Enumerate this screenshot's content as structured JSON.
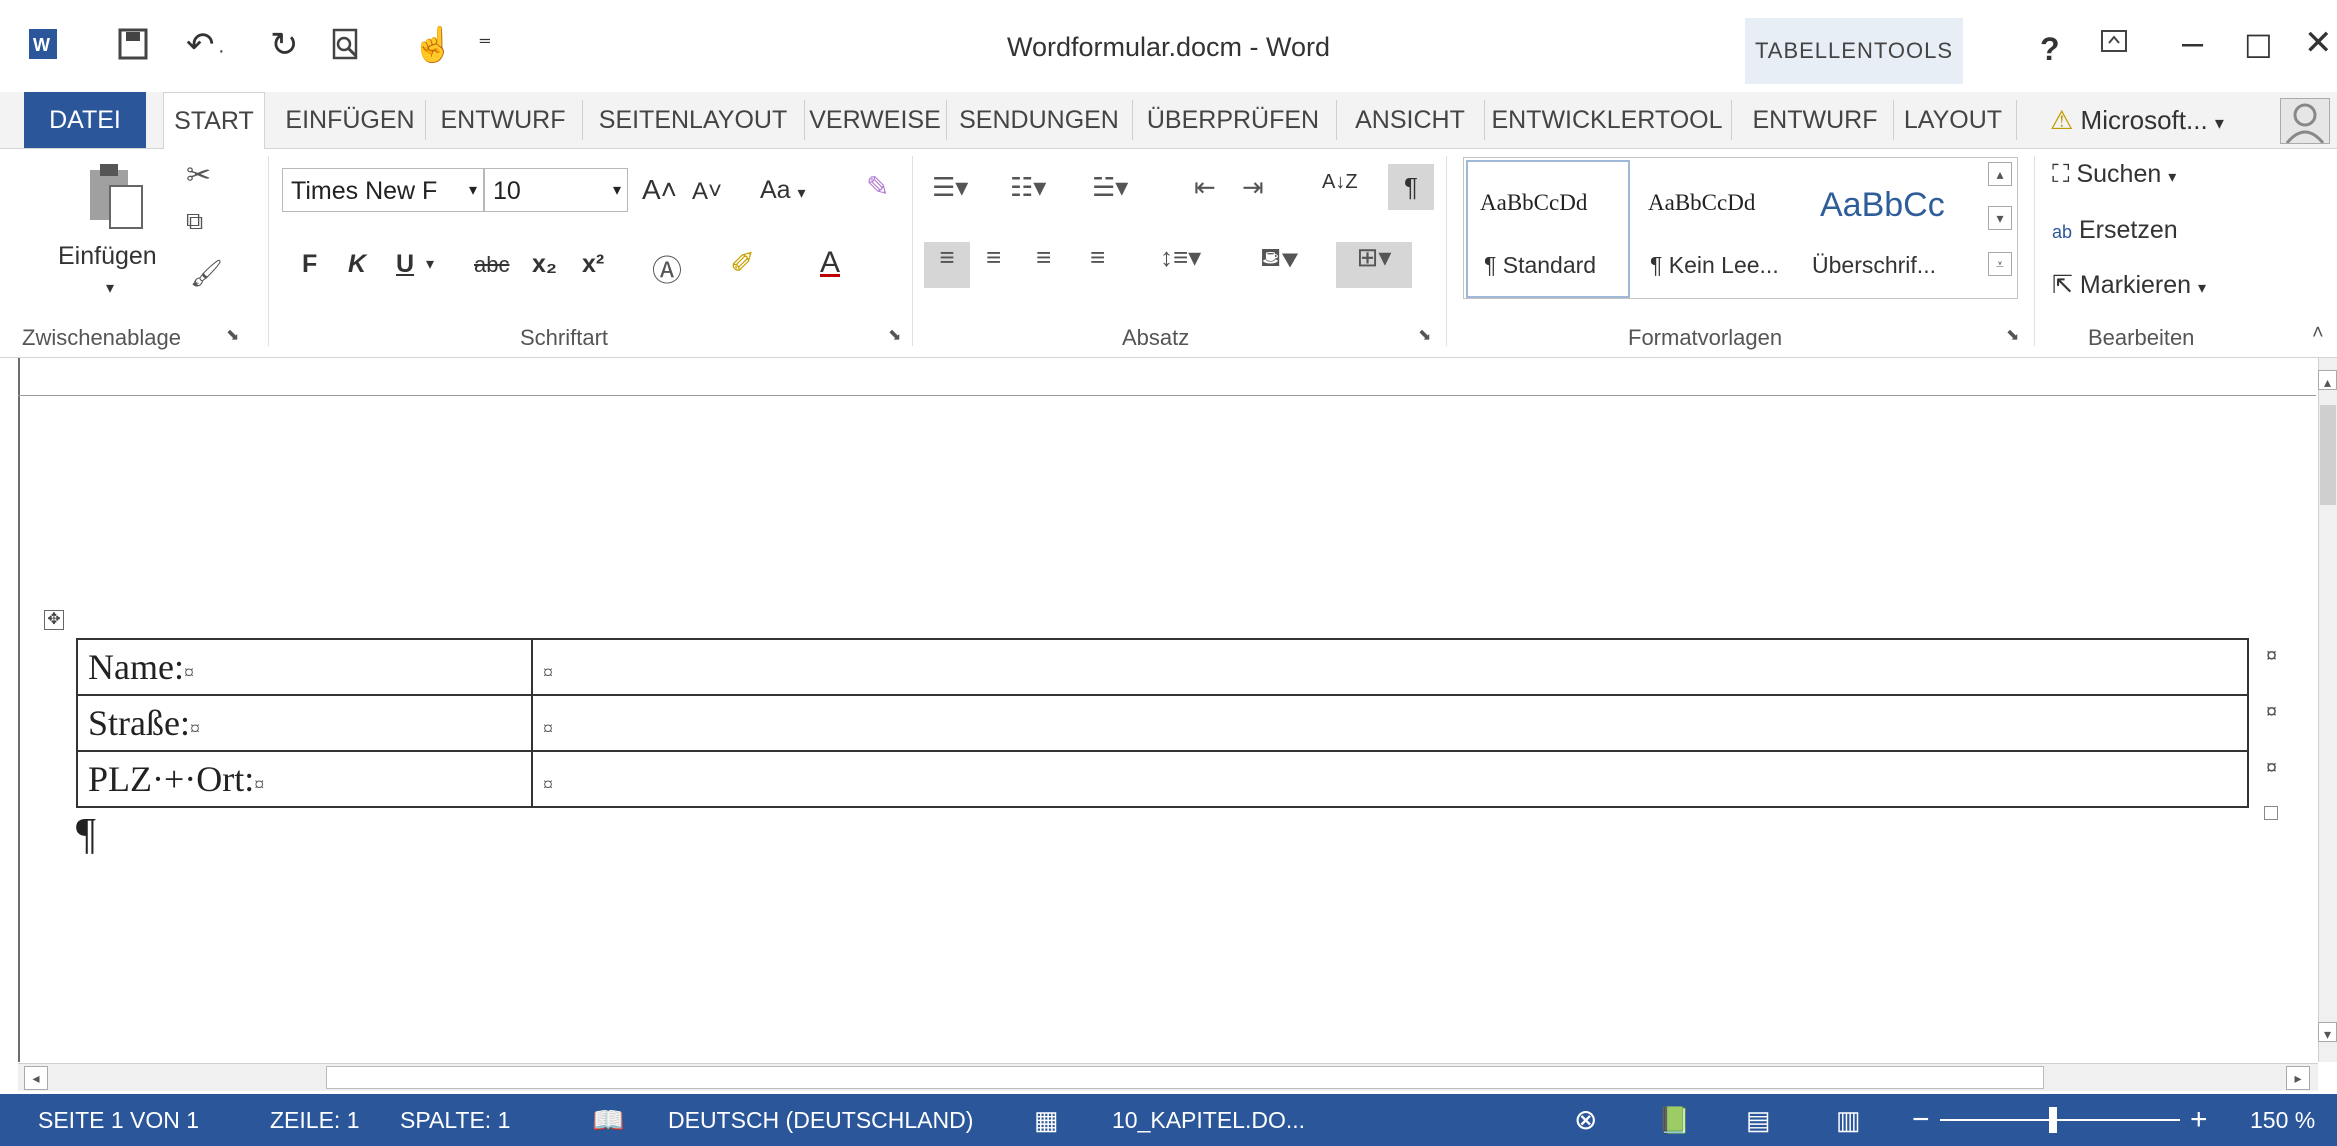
{
  "window": {
    "title": "Wordformular.docm - Word",
    "contextual_tab_group": "TABELLENTOOLS",
    "controls": {
      "help": "?",
      "ribbon_options": "⌅",
      "minimize": "–",
      "maximize": "☐",
      "close": "✕"
    }
  },
  "quick_access": {
    "save_icon": "💾",
    "undo_icon": "↶",
    "redo_icon": "↻",
    "preview_icon": "🔍",
    "touch_icon": "☝",
    "customize": "⁼"
  },
  "tabs": {
    "datei": "DATEI",
    "start": "START",
    "einfuegen": "EINFÜGEN",
    "entwurf": "ENTWURF",
    "seitenlayout": "SEITENLAYOUT",
    "verweise": "VERWEISE",
    "sendungen": "SENDUNGEN",
    "ueberpruefen": "ÜBERPRÜFEN",
    "ansicht": "ANSICHT",
    "entwicklertool": "ENTWICKLERTOOL",
    "entwurf2": "ENTWURF",
    "layout": "LAYOUT"
  },
  "account": {
    "name": "Microsoft...",
    "warning_icon": "⚠"
  },
  "ribbon": {
    "clipboard": {
      "paste": "Einfügen",
      "label": "Zwischenablage"
    },
    "font": {
      "font_name": "Times New F",
      "font_size": "10",
      "grow": "A˄",
      "shrink": "A˅",
      "case": "Aa",
      "bold": "F",
      "italic": "K",
      "underline": "U",
      "strike": "abc",
      "sub": "x₂",
      "sup": "x²",
      "label": "Schriftart"
    },
    "paragraph": {
      "label": "Absatz",
      "sort": "A↓Z",
      "pilcrow": "¶"
    },
    "styles": {
      "label": "Formatvorlagen",
      "items": [
        {
          "sample": "AaBbCcDd",
          "name": "¶ Standard"
        },
        {
          "sample": "AaBbCcDd",
          "name": "¶ Kein Lee..."
        },
        {
          "sample": "AaBbCc",
          "name": "Überschrif..."
        }
      ]
    },
    "editing": {
      "find": "Suchen",
      "replace": "Ersetzen",
      "select": "Markieren",
      "label": "Bearbeiten"
    }
  },
  "document": {
    "rows": [
      {
        "label": "Name:",
        "value": ""
      },
      {
        "label": "Straße:",
        "value": ""
      },
      {
        "label": "PLZ·+·Ort:",
        "value": ""
      }
    ],
    "cell_marker": "¤",
    "pilcrow": "¶"
  },
  "status": {
    "page": "SEITE 1 VON 1",
    "line": "ZEILE: 1",
    "column": "SPALTE: 1",
    "language": "DEUTSCH (DEUTSCHLAND)",
    "macro_doc": "10_KAPITEL.DO...",
    "zoom": "150 %",
    "zoom_fraction": 0.47
  }
}
